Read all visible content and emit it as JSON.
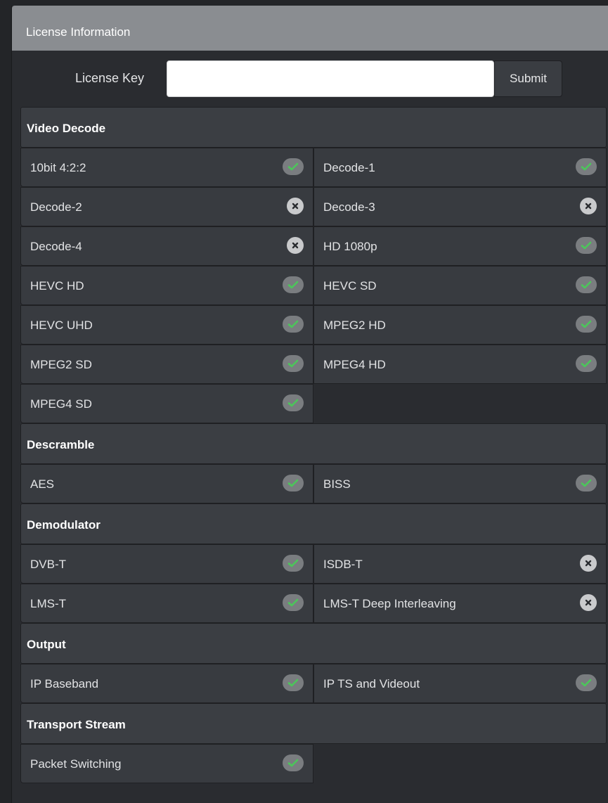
{
  "panel": {
    "title": "License Information"
  },
  "license": {
    "label": "License Key",
    "value": "",
    "placeholder": "",
    "submit_label": "Submit"
  },
  "sections": [
    {
      "title": "Video Decode",
      "items": [
        {
          "label": "10bit 4:2:2",
          "enabled": true
        },
        {
          "label": "Decode-1",
          "enabled": true
        },
        {
          "label": "Decode-2",
          "enabled": false
        },
        {
          "label": "Decode-3",
          "enabled": false
        },
        {
          "label": "Decode-4",
          "enabled": false
        },
        {
          "label": "HD 1080p",
          "enabled": true
        },
        {
          "label": "HEVC HD",
          "enabled": true
        },
        {
          "label": "HEVC SD",
          "enabled": true
        },
        {
          "label": "HEVC UHD",
          "enabled": true
        },
        {
          "label": "MPEG2 HD",
          "enabled": true
        },
        {
          "label": "MPEG2 SD",
          "enabled": true
        },
        {
          "label": "MPEG4 HD",
          "enabled": true
        },
        {
          "label": "MPEG4 SD",
          "enabled": true
        }
      ]
    },
    {
      "title": "Descramble",
      "items": [
        {
          "label": "AES",
          "enabled": true
        },
        {
          "label": "BISS",
          "enabled": true
        }
      ]
    },
    {
      "title": "Demodulator",
      "items": [
        {
          "label": "DVB-T",
          "enabled": true
        },
        {
          "label": "ISDB-T",
          "enabled": false
        },
        {
          "label": "LMS-T",
          "enabled": true
        },
        {
          "label": "LMS-T Deep Interleaving",
          "enabled": false
        }
      ]
    },
    {
      "title": "Output",
      "items": [
        {
          "label": "IP Baseband",
          "enabled": true
        },
        {
          "label": "IP TS and Videout",
          "enabled": true
        }
      ]
    },
    {
      "title": "Transport Stream",
      "items": [
        {
          "label": "Packet Switching",
          "enabled": true
        }
      ]
    }
  ],
  "icons": {
    "enabled": "check-icon",
    "disabled": "x-icon"
  },
  "colors": {
    "check": "#4cc65a",
    "badge_on": "#7a7d80",
    "badge_off": "#c9cacc",
    "header": "#8a8d91"
  }
}
